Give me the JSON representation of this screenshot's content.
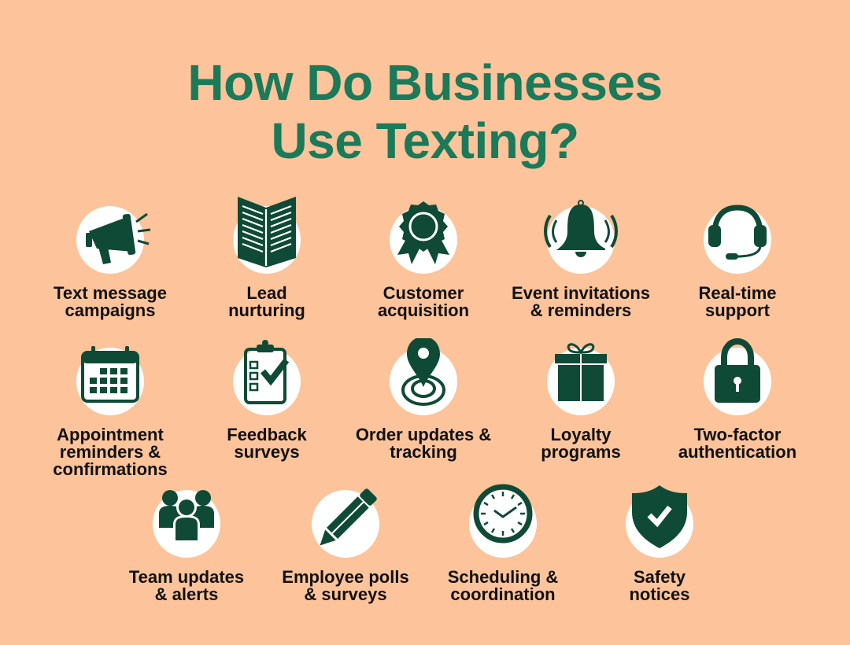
{
  "title_line1": "How Do Businesses",
  "title_line2": "Use Texting?",
  "colors": {
    "background": "#fdc39a",
    "title": "#1a7a59",
    "icon": "#0f4a36",
    "circle": "#ffffff",
    "label": "#111111"
  },
  "items": [
    {
      "icon": "megaphone-icon",
      "line1": "Text message",
      "line2": "campaigns",
      "line3": ""
    },
    {
      "icon": "book-icon",
      "line1": "Lead",
      "line2": "nurturing",
      "line3": ""
    },
    {
      "icon": "award-ribbon-icon",
      "line1": "Customer",
      "line2": "acquisition",
      "line3": ""
    },
    {
      "icon": "bell-icon",
      "line1": "Event invitations",
      "line2": "& reminders",
      "line3": ""
    },
    {
      "icon": "headset-icon",
      "line1": "Real-time",
      "line2": "support",
      "line3": ""
    },
    {
      "icon": "calendar-icon",
      "line1": "Appointment",
      "line2": "reminders &",
      "line3": "confirmations"
    },
    {
      "icon": "clipboard-check-icon",
      "line1": "Feedback",
      "line2": "surveys",
      "line3": ""
    },
    {
      "icon": "location-pin-icon",
      "line1": "Order updates &",
      "line2": "tracking",
      "line3": ""
    },
    {
      "icon": "gift-icon",
      "line1": "Loyalty",
      "line2": "programs",
      "line3": ""
    },
    {
      "icon": "padlock-icon",
      "line1": "Two-factor",
      "line2": "authentication",
      "line3": ""
    },
    {
      "icon": "team-icon",
      "line1": "Team updates",
      "line2": "& alerts",
      "line3": ""
    },
    {
      "icon": "pencil-icon",
      "line1": "Employee polls",
      "line2": "& surveys",
      "line3": ""
    },
    {
      "icon": "clock-icon",
      "line1": "Scheduling &",
      "line2": "coordination",
      "line3": ""
    },
    {
      "icon": "shield-check-icon",
      "line1": "Safety",
      "line2": "notices",
      "line3": ""
    }
  ]
}
